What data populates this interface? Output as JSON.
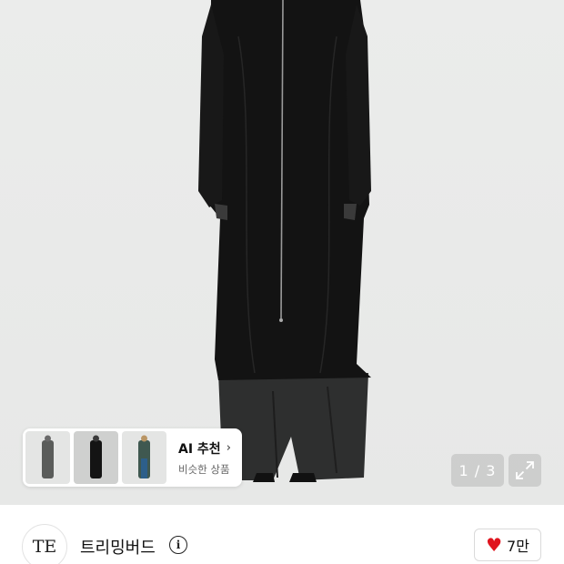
{
  "product_image": {
    "alt": "black long zip-up coat"
  },
  "ai_recommend": {
    "title": "AI 추천",
    "chevron": "›",
    "subtitle": "비슷한 상품",
    "thumbnails": [
      "thumbnail-grey-coat",
      "thumbnail-black-coat",
      "thumbnail-green-coat"
    ]
  },
  "gallery": {
    "counter": "1 / 3",
    "expand_icon": "expand-icon"
  },
  "brand": {
    "logo_text": "TE",
    "name": "트리밍버드",
    "info_icon": "i"
  },
  "like": {
    "icon": "heart-icon",
    "count": "7만",
    "color": "#e0141e"
  }
}
